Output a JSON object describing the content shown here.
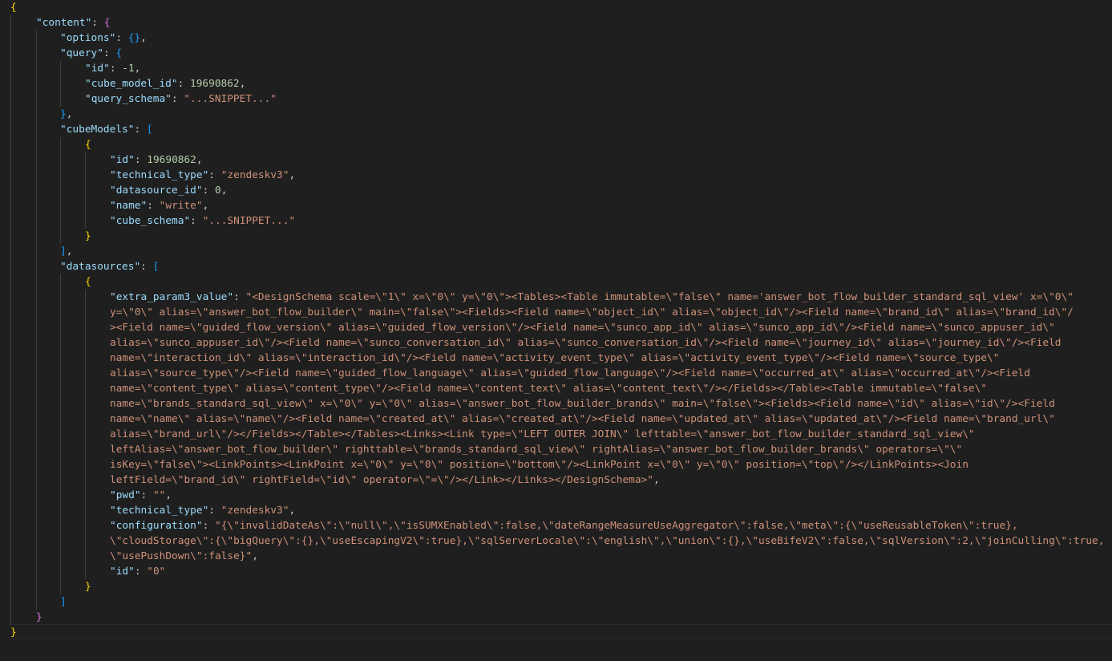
{
  "editor": {
    "language": "json",
    "colors": {
      "background": "#1f1f1f",
      "key": "#9cdcfe",
      "string": "#ce9178",
      "number": "#b5cea8",
      "punctuation": "#cccccc",
      "bracket_level_1": "#ffd700",
      "bracket_level_2": "#da70d6",
      "bracket_level_3": "#179fff"
    },
    "lines": [
      [
        {
          "c": "b1",
          "t": "{"
        }
      ],
      [
        {
          "c": "k",
          "t": "\"content\""
        },
        {
          "c": "p",
          "t": ": "
        },
        {
          "c": "b2",
          "t": "{"
        }
      ],
      [
        {
          "c": "k",
          "t": "\"options\""
        },
        {
          "c": "p",
          "t": ": "
        },
        {
          "c": "b3",
          "t": "{}"
        },
        {
          "c": "p",
          "t": ","
        }
      ],
      [
        {
          "c": "k",
          "t": "\"query\""
        },
        {
          "c": "p",
          "t": ": "
        },
        {
          "c": "b3",
          "t": "{"
        }
      ],
      [
        {
          "c": "k",
          "t": "\"id\""
        },
        {
          "c": "p",
          "t": ": "
        },
        {
          "c": "n",
          "t": "-1"
        },
        {
          "c": "p",
          "t": ","
        }
      ],
      [
        {
          "c": "k",
          "t": "\"cube_model_id\""
        },
        {
          "c": "p",
          "t": ": "
        },
        {
          "c": "n",
          "t": "19690862"
        },
        {
          "c": "p",
          "t": ","
        }
      ],
      [
        {
          "c": "k",
          "t": "\"query_schema\""
        },
        {
          "c": "p",
          "t": ": "
        },
        {
          "c": "s",
          "t": "\"...SNIPPET...\""
        }
      ],
      [
        {
          "c": "b3",
          "t": "}"
        },
        {
          "c": "p",
          "t": ","
        }
      ],
      [
        {
          "c": "k",
          "t": "\"cubeModels\""
        },
        {
          "c": "p",
          "t": ": "
        },
        {
          "c": "b3",
          "t": "["
        }
      ],
      [
        {
          "c": "b1",
          "t": "{"
        }
      ],
      [
        {
          "c": "k",
          "t": "\"id\""
        },
        {
          "c": "p",
          "t": ": "
        },
        {
          "c": "n",
          "t": "19690862"
        },
        {
          "c": "p",
          "t": ","
        }
      ],
      [
        {
          "c": "k",
          "t": "\"technical_type\""
        },
        {
          "c": "p",
          "t": ": "
        },
        {
          "c": "s",
          "t": "\"zendeskv3\""
        },
        {
          "c": "p",
          "t": ","
        }
      ],
      [
        {
          "c": "k",
          "t": "\"datasource_id\""
        },
        {
          "c": "p",
          "t": ": "
        },
        {
          "c": "n",
          "t": "0"
        },
        {
          "c": "p",
          "t": ","
        }
      ],
      [
        {
          "c": "k",
          "t": "\"name\""
        },
        {
          "c": "p",
          "t": ": "
        },
        {
          "c": "s",
          "t": "\"write\""
        },
        {
          "c": "p",
          "t": ","
        }
      ],
      [
        {
          "c": "k",
          "t": "\"cube_schema\""
        },
        {
          "c": "p",
          "t": ": "
        },
        {
          "c": "s",
          "t": "\"...SNIPPET...\""
        }
      ],
      [
        {
          "c": "b1",
          "t": "}"
        }
      ],
      [
        {
          "c": "b3",
          "t": "]"
        },
        {
          "c": "p",
          "t": ","
        }
      ],
      [
        {
          "c": "k",
          "t": "\"datasources\""
        },
        {
          "c": "p",
          "t": ": "
        },
        {
          "c": "b3",
          "t": "["
        }
      ],
      [
        {
          "c": "b1",
          "t": "{"
        }
      ],
      [
        {
          "c": "k",
          "t": "\"extra_param3_value\""
        },
        {
          "c": "p",
          "t": ": "
        },
        {
          "c": "s",
          "t": "\"<DesignSchema scale=\\\"1\\\" x=\\\"0\\\" y=\\\"0\\\"><Tables><Table immutable=\\\"false\\\" name='answer_bot_flow_builder_standard_sql_view' x=\\\"0\\\""
        }
      ],
      [
        {
          "c": "s",
          "t": "y=\\\"0\\\" alias=\\\"answer_bot_flow_builder\\\" main=\\\"false\\\"><Fields><Field name=\\\"object_id\\\" alias=\\\"object_id\\\"/><Field name=\\\"brand_id\\\" alias=\\\"brand_id\\\"/"
        }
      ],
      [
        {
          "c": "s",
          "t": "><Field name=\\\"guided_flow_version\\\" alias=\\\"guided_flow_version\\\"/><Field name=\\\"sunco_app_id\\\" alias=\\\"sunco_app_id\\\"/><Field name=\\\"sunco_appuser_id\\\""
        }
      ],
      [
        {
          "c": "s",
          "t": "alias=\\\"sunco_appuser_id\\\"/><Field name=\\\"sunco_conversation_id\\\" alias=\\\"sunco_conversation_id\\\"/><Field name=\\\"journey_id\\\" alias=\\\"journey_id\\\"/><Field"
        }
      ],
      [
        {
          "c": "s",
          "t": "name=\\\"interaction_id\\\" alias=\\\"interaction_id\\\"/><Field name=\\\"activity_event_type\\\" alias=\\\"activity_event_type\\\"/><Field name=\\\"source_type\\\""
        }
      ],
      [
        {
          "c": "s",
          "t": "alias=\\\"source_type\\\"/><Field name=\\\"guided_flow_language\\\" alias=\\\"guided_flow_language\\\"/><Field name=\\\"occurred_at\\\" alias=\\\"occurred_at\\\"/><Field"
        }
      ],
      [
        {
          "c": "s",
          "t": "name=\\\"content_type\\\" alias=\\\"content_type\\\"/><Field name=\\\"content_text\\\" alias=\\\"content_text\\\"/></Fields></Table><Table immutable=\\\"false\\\""
        }
      ],
      [
        {
          "c": "s",
          "t": "name=\\\"brands_standard_sql_view\\\" x=\\\"0\\\" y=\\\"0\\\" alias=\\\"answer_bot_flow_builder_brands\\\" main=\\\"false\\\"><Fields><Field name=\\\"id\\\" alias=\\\"id\\\"/><Field"
        }
      ],
      [
        {
          "c": "s",
          "t": "name=\\\"name\\\" alias=\\\"name\\\"/><Field name=\\\"created_at\\\" alias=\\\"created_at\\\"/><Field name=\\\"updated_at\\\" alias=\\\"updated_at\\\"/><Field name=\\\"brand_url\\\""
        }
      ],
      [
        {
          "c": "s",
          "t": "alias=\\\"brand_url\\\"/></Fields></Table></Tables><Links><Link type=\\\"LEFT OUTER JOIN\\\" lefttable=\\\"answer_bot_flow_builder_standard_sql_view\\\""
        }
      ],
      [
        {
          "c": "s",
          "t": "leftAlias=\\\"answer_bot_flow_builder\\\" righttable=\\\"brands_standard_sql_view\\\" rightAlias=\\\"answer_bot_flow_builder_brands\\\" operators=\\\"\\\""
        }
      ],
      [
        {
          "c": "s",
          "t": "isKey=\\\"false\\\"><LinkPoints><LinkPoint x=\\\"0\\\" y=\\\"0\\\" position=\\\"bottom\\\"/><LinkPoint x=\\\"0\\\" y=\\\"0\\\" position=\\\"top\\\"/></LinkPoints><Join"
        }
      ],
      [
        {
          "c": "s",
          "t": "leftField=\\\"brand_id\\\" rightField=\\\"id\\\" operator=\\\"=\\\"/></Link></Links></DesignSchema>\""
        },
        {
          "c": "p",
          "t": ","
        }
      ],
      [
        {
          "c": "k",
          "t": "\"pwd\""
        },
        {
          "c": "p",
          "t": ": "
        },
        {
          "c": "s",
          "t": "\"\""
        },
        {
          "c": "p",
          "t": ","
        }
      ],
      [
        {
          "c": "k",
          "t": "\"technical_type\""
        },
        {
          "c": "p",
          "t": ": "
        },
        {
          "c": "s",
          "t": "\"zendeskv3\""
        },
        {
          "c": "p",
          "t": ","
        }
      ],
      [
        {
          "c": "k",
          "t": "\"configuration\""
        },
        {
          "c": "p",
          "t": ": "
        },
        {
          "c": "s",
          "t": "\"{\\\"invalidDateAs\\\":\\\"null\\\",\\\"isSUMXEnabled\\\":false,\\\"dateRangeMeasureUseAggregator\\\":false,\\\"meta\\\":{\\\"useReusableToken\\\":true},"
        }
      ],
      [
        {
          "c": "s",
          "t": "\\\"cloudStorage\\\":{\\\"bigQuery\\\":{},\\\"useEscapingV2\\\":true},\\\"sqlServerLocale\\\":\\\"english\\\",\\\"union\\\":{},\\\"useBifeV2\\\":false,\\\"sqlVersion\\\":2,\\\"joinCulling\\\":true,"
        }
      ],
      [
        {
          "c": "s",
          "t": "\\\"usePushDown\\\":false}\""
        },
        {
          "c": "p",
          "t": ","
        }
      ],
      [
        {
          "c": "k",
          "t": "\"id\""
        },
        {
          "c": "p",
          "t": ": "
        },
        {
          "c": "s",
          "t": "\"0\""
        }
      ],
      [
        {
          "c": "b1",
          "t": "}"
        }
      ],
      [
        {
          "c": "b3",
          "t": "]"
        }
      ],
      [
        {
          "c": "b2",
          "t": "}"
        }
      ],
      [
        {
          "c": "b1",
          "t": "}"
        }
      ]
    ]
  }
}
